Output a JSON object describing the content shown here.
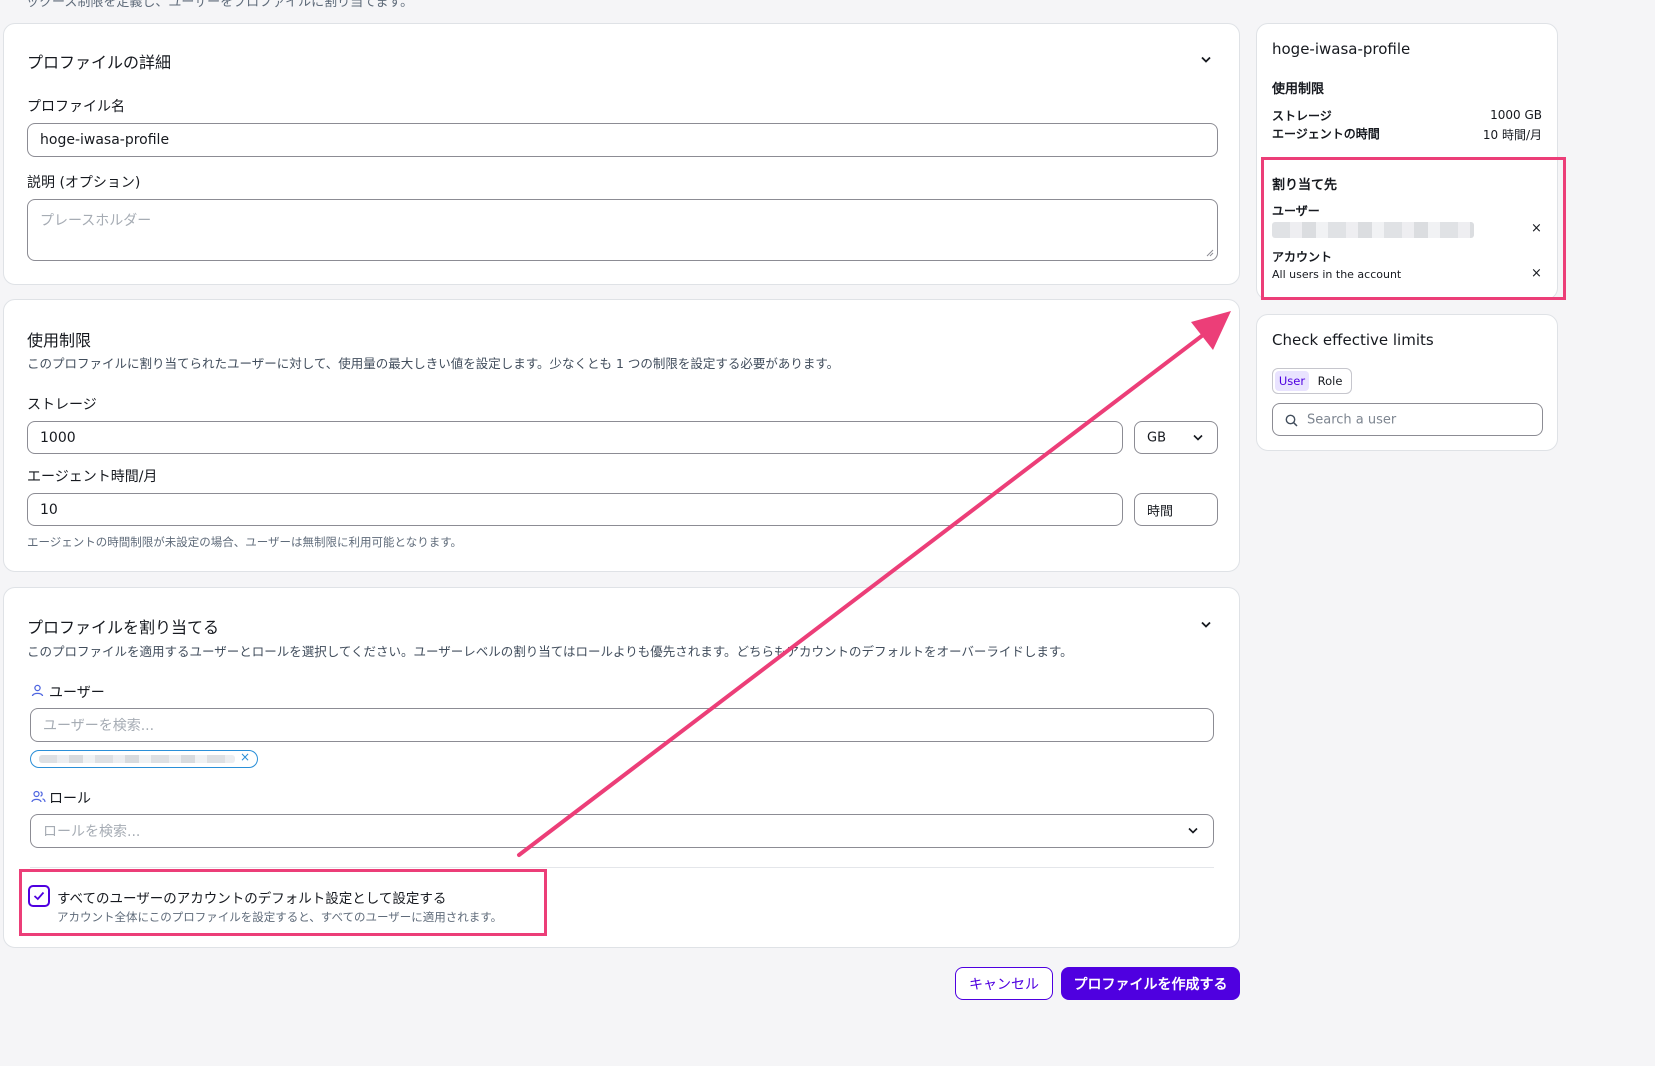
{
  "page": {
    "top_desc": "ックース制限を定義し、ユーザーをプロファイルに割り当てます。"
  },
  "details": {
    "title": "プロファイルの詳細",
    "name_label": "プロファイル名",
    "name_value": "hoge-iwasa-profile",
    "desc_label": "説明 (オプション)",
    "desc_placeholder": "プレースホルダー"
  },
  "limits": {
    "title": "使用制限",
    "desc": "このプロファイルに割り当てられたユーザーに対して、使用量の最大しきい値を設定します。少なくとも 1 つの制限を設定する必要があります。",
    "storage_label": "ストレージ",
    "storage_value": "1000",
    "storage_unit": "GB",
    "agent_label": "エージェント時間/月",
    "agent_value": "10",
    "agent_unit": "時間",
    "agent_hint": "エージェントの時間制限が未設定の場合、ユーザーは無制限に利用可能となります。"
  },
  "assign": {
    "title": "プロファイルを割り当てる",
    "desc": "このプロファイルを適用するユーザーとロールを選択してください。ユーザーレベルの割り当てはロールよりも優先されます。どちらもアカウントのデフォルトをオーバーライドします。",
    "user_label": "ユーザー",
    "user_placeholder": "ユーザーを検索...",
    "role_label": "ロール",
    "role_placeholder": "ロールを検索...",
    "default_label": "すべてのユーザーのアカウントのデフォルト設定として設定する",
    "default_hint": "アカウント全体にこのプロファイルを設定すると、すべてのユーザーに適用されます。",
    "default_checked": true
  },
  "actions": {
    "cancel": "キャンセル",
    "create": "プロファイルを作成する"
  },
  "summary": {
    "title": "hoge-iwasa-profile",
    "limits_heading": "使用制限",
    "storage_label": "ストレージ",
    "storage_value": "1000 GB",
    "agent_label": "エージェントの時間",
    "agent_value": "10 時間/月",
    "assign_heading": "割り当て先",
    "user_heading": "ユーザー",
    "account_heading": "アカウント",
    "account_value": "All users in the account"
  },
  "effective": {
    "title": "Check effective limits",
    "tab_user": "User",
    "tab_role": "Role",
    "search_placeholder": "Search a user"
  },
  "colors": {
    "primary": "#4f00e0",
    "highlight": "#ec3e78",
    "border": "#8c8c94"
  }
}
